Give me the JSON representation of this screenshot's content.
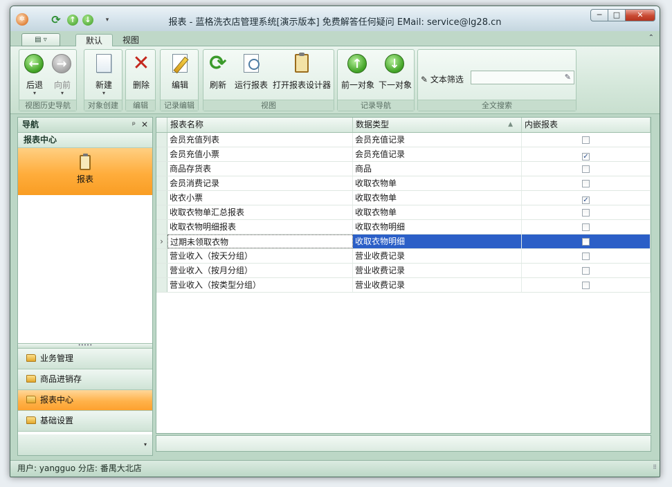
{
  "window": {
    "title": "报表 - 蓝格洗衣店管理系统[演示版本] 免费解答任何疑问 EMail: service@lg28.cn",
    "app_icon": "app-logo-icon",
    "controls": {
      "minimize": "─",
      "maximize": "□",
      "close": "✕"
    }
  },
  "quick_access": {
    "dropdown": "▾"
  },
  "ribbon": {
    "tabs": [
      {
        "label": "默认",
        "active": true
      },
      {
        "label": "视图",
        "active": false
      }
    ],
    "collapse": "«",
    "groups": [
      {
        "label": "视图历史导航",
        "buttons": [
          {
            "label": "后退",
            "icon": "back-arrow-icon",
            "enabled": true
          },
          {
            "label": "向前",
            "icon": "forward-arrow-icon",
            "enabled": false
          }
        ]
      },
      {
        "label": "对象创建",
        "buttons": [
          {
            "label": "新建",
            "icon": "new-document-icon"
          }
        ]
      },
      {
        "label": "编辑",
        "buttons": [
          {
            "label": "删除",
            "icon": "delete-x-icon"
          }
        ]
      },
      {
        "label": "记录编辑",
        "buttons": [
          {
            "label": "编辑",
            "icon": "edit-pencil-icon"
          }
        ]
      },
      {
        "label": "视图",
        "buttons": [
          {
            "label": "刷新",
            "icon": "refresh-icon"
          },
          {
            "label": "运行报表",
            "icon": "run-report-icon"
          },
          {
            "label": "打开报表设计器",
            "icon": "report-designer-icon"
          }
        ]
      },
      {
        "label": "记录导航",
        "buttons": [
          {
            "label": "前一对象",
            "icon": "previous-object-icon"
          },
          {
            "label": "下一对象",
            "icon": "next-object-icon"
          }
        ]
      },
      {
        "label": "全文搜索",
        "filter_label": "文本筛选",
        "filter_value": ""
      }
    ]
  },
  "nav": {
    "title": "导航",
    "pin": "ᵖ",
    "close": "✕",
    "section": "报表中心",
    "tile": {
      "label": "报表",
      "icon": "report-clipboard-icon"
    },
    "splitter": "•••••",
    "groups": [
      {
        "label": "业务管理",
        "active": false
      },
      {
        "label": "商品进销存",
        "active": false
      },
      {
        "label": "报表中心",
        "active": true
      },
      {
        "label": "基础设置",
        "active": false
      }
    ],
    "footer_arrow": "▾"
  },
  "grid": {
    "columns": [
      "报表名称",
      "数据类型",
      "内嵌报表"
    ],
    "sort_indicator": "▲",
    "rows": [
      {
        "name": "会员充值列表",
        "type": "会员充值记录",
        "embedded": false
      },
      {
        "name": "会员充值小票",
        "type": "会员充值记录",
        "embedded": true
      },
      {
        "name": "商品存货表",
        "type": "商品",
        "embedded": false
      },
      {
        "name": "会员消费记录",
        "type": "收取衣物单",
        "embedded": false
      },
      {
        "name": "收衣小票",
        "type": "收取衣物单",
        "embedded": true
      },
      {
        "name": "收取衣物单汇总报表",
        "type": "收取衣物单",
        "embedded": false
      },
      {
        "name": "收取衣物明细报表",
        "type": "收取衣物明细",
        "embedded": false
      },
      {
        "name": "过期未领取衣物",
        "type": "收取衣物明细",
        "embedded": false,
        "selected": true
      },
      {
        "name": "营业收入（按天分组）",
        "type": "营业收费记录",
        "embedded": false
      },
      {
        "name": "营业收入（按月分组）",
        "type": "营业收费记录",
        "embedded": false
      },
      {
        "name": "营业收入（按类型分组）",
        "type": "营业收费记录",
        "embedded": false
      }
    ],
    "current_row_marker": "›",
    "check_mark": "✓"
  },
  "status": {
    "text": "用户: yangguo  分店: 番禺大北店",
    "grip": "⠿"
  }
}
